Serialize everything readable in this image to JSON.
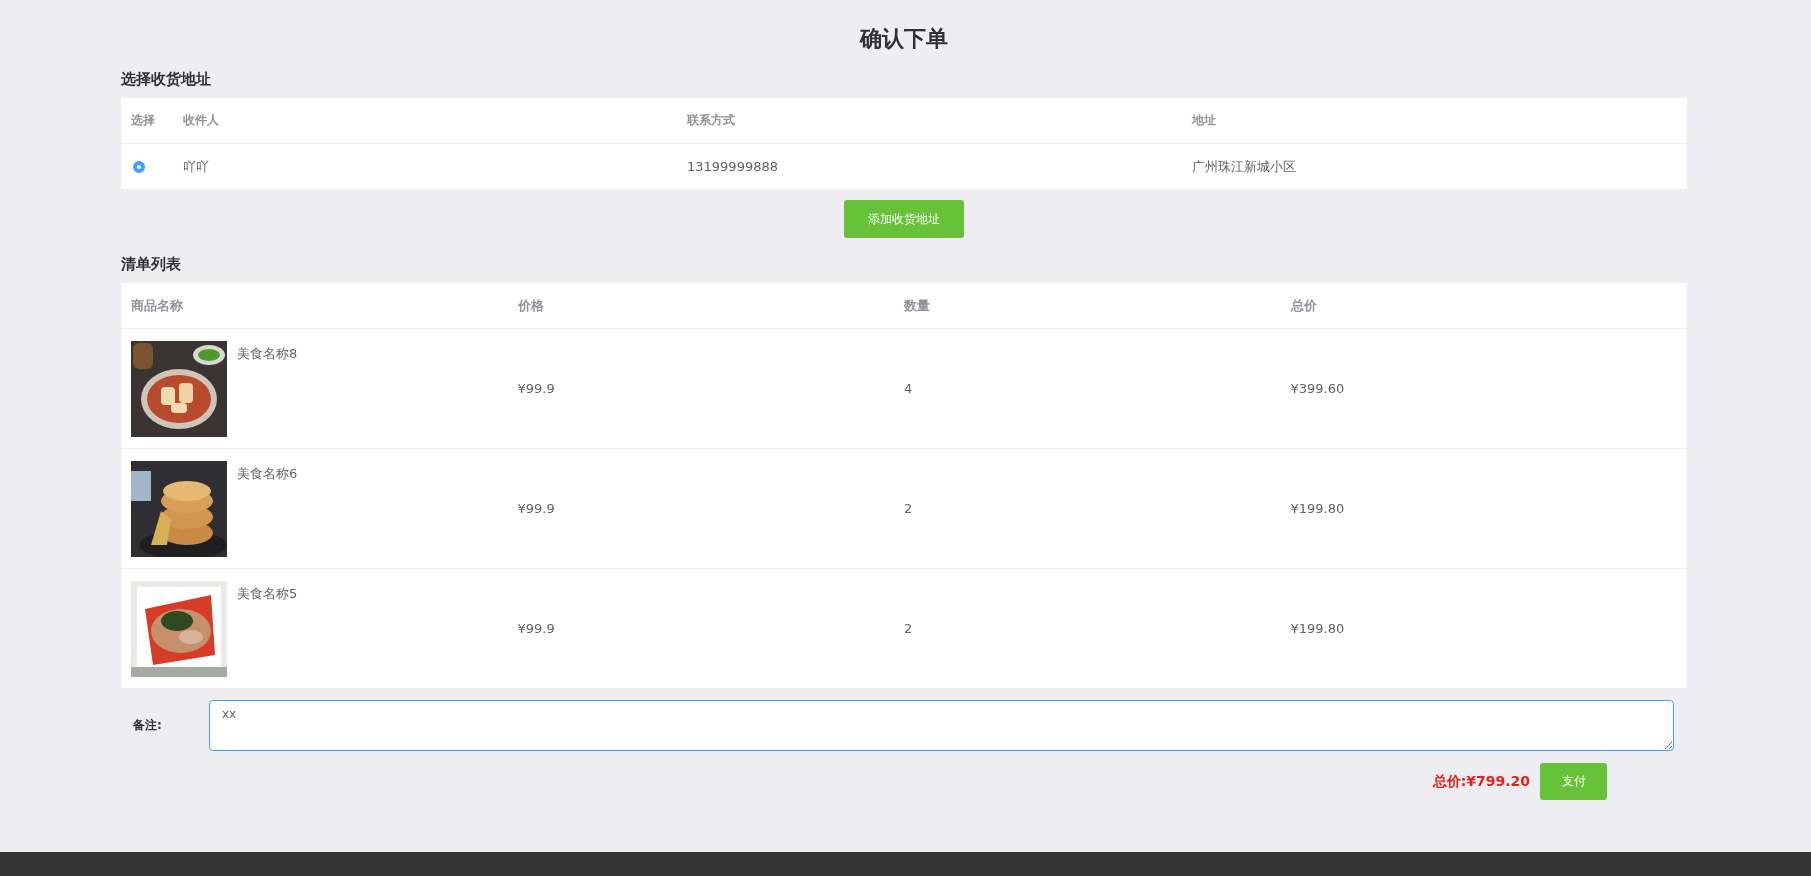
{
  "title": "确认下单",
  "address_section": {
    "heading": "选择收货地址",
    "columns": [
      "选择",
      "收件人",
      "联系方式",
      "地址"
    ],
    "rows": [
      {
        "selected": true,
        "recipient": "吖吖",
        "phone": "13199999888",
        "address": "广州珠江新城小区"
      }
    ],
    "add_button": "添加收货地址"
  },
  "list_section": {
    "heading": "清单列表",
    "columns": [
      "商品名称",
      "价格",
      "数量",
      "总价"
    ],
    "rows": [
      {
        "name": "美食名称8",
        "price": "¥99.9",
        "quantity": "4",
        "total": "¥399.60"
      },
      {
        "name": "美食名称6",
        "price": "¥99.9",
        "quantity": "2",
        "total": "¥199.80"
      },
      {
        "name": "美食名称5",
        "price": "¥99.9",
        "quantity": "2",
        "total": "¥199.80"
      }
    ]
  },
  "remark": {
    "label": "备注:",
    "value": "xx"
  },
  "total": {
    "label": "总价:",
    "amount": "¥799.20"
  },
  "pay_button": "支付"
}
